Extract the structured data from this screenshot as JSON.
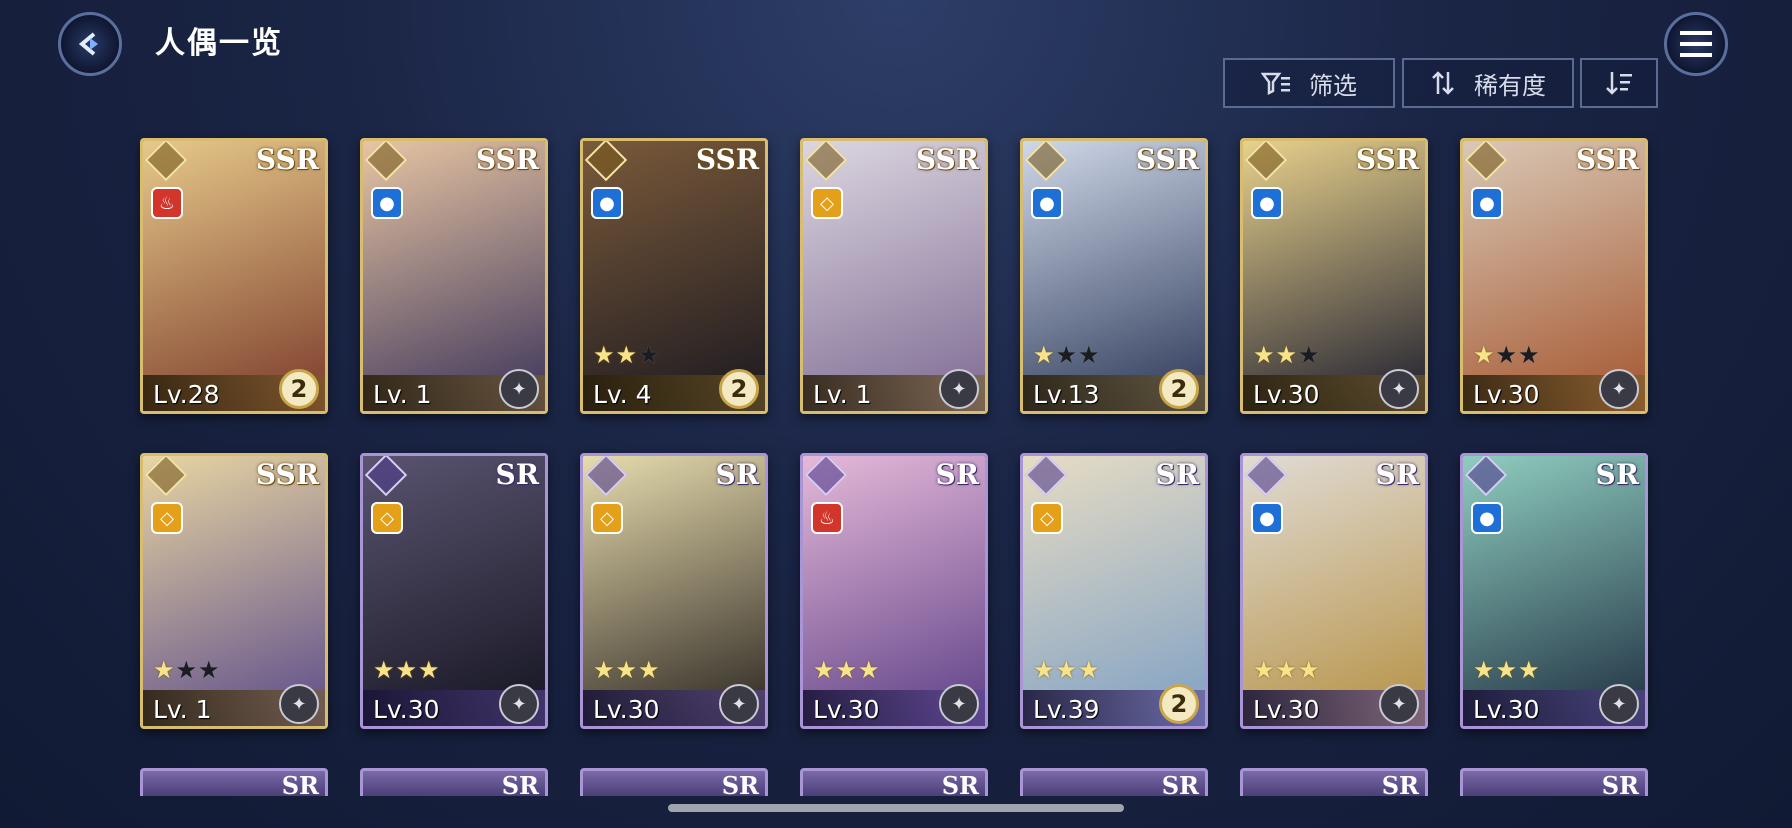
{
  "header": {
    "title": "人偶一览",
    "back_icon": "back-arrow-icon",
    "menu_icon": "hamburger-menu-icon"
  },
  "toolbar": {
    "filter_label": "筛选",
    "sort_label": "稀有度",
    "filter_icon": "filter-icon",
    "sort_icon": "sort-arrows-icon",
    "order_icon": "sort-order-icon"
  },
  "cards": [
    {
      "rarity": "SSR",
      "element": "fire",
      "stars": 0,
      "level": "Lv.28",
      "badge": "2",
      "colors": [
        "#e6c98a",
        "#7b3a2a"
      ]
    },
    {
      "rarity": "SSR",
      "element": "water",
      "stars": 0,
      "level": "Lv. 1",
      "badge": "",
      "colors": [
        "#e7c5a3",
        "#3a3359"
      ]
    },
    {
      "rarity": "SSR",
      "element": "water",
      "stars": 2,
      "level": "Lv. 4",
      "badge": "2",
      "colors": [
        "#7a5a3a",
        "#1a1820"
      ]
    },
    {
      "rarity": "SSR",
      "element": "light",
      "stars": 0,
      "level": "Lv. 1",
      "badge": "",
      "colors": [
        "#dcd6e0",
        "#7d6a92"
      ]
    },
    {
      "rarity": "SSR",
      "element": "water",
      "stars": 1,
      "level": "Lv.13",
      "badge": "2",
      "colors": [
        "#cfd8e8",
        "#2a3656"
      ]
    },
    {
      "rarity": "SSR",
      "element": "water",
      "stars": 2,
      "level": "Lv.30",
      "badge": "",
      "colors": [
        "#e8d18c",
        "#1b1c2e"
      ]
    },
    {
      "rarity": "SSR",
      "element": "water",
      "stars": 1,
      "level": "Lv.30",
      "badge": "",
      "colors": [
        "#d9c8b6",
        "#a4552e"
      ]
    },
    {
      "rarity": "SSR",
      "element": "light",
      "stars": 1,
      "level": "Lv. 1",
      "badge": "",
      "colors": [
        "#e8d5a2",
        "#5b4b8a"
      ]
    },
    {
      "rarity": "SR",
      "element": "light",
      "stars": 3,
      "level": "Lv.30",
      "badge": "",
      "colors": [
        "#5a5470",
        "#141420"
      ]
    },
    {
      "rarity": "SR",
      "element": "light",
      "stars": 3,
      "level": "Lv.30",
      "badge": "",
      "colors": [
        "#e7dcae",
        "#2a2420"
      ]
    },
    {
      "rarity": "SR",
      "element": "fire",
      "stars": 3,
      "level": "Lv.30",
      "badge": "",
      "colors": [
        "#e5b9d8",
        "#5c3f86"
      ]
    },
    {
      "rarity": "SR",
      "element": "light",
      "stars": 3,
      "level": "Lv.39",
      "badge": "2",
      "colors": [
        "#e7dcc4",
        "#7ea0c4"
      ]
    },
    {
      "rarity": "SR",
      "element": "water",
      "stars": 3,
      "level": "Lv.30",
      "badge": "",
      "colors": [
        "#e0dbd4",
        "#b59042"
      ]
    },
    {
      "rarity": "SR",
      "element": "water",
      "stars": 3,
      "level": "Lv.30",
      "badge": "",
      "colors": [
        "#8fcdbf",
        "#1e2e40"
      ]
    }
  ],
  "peek_row": [
    "SR",
    "SR",
    "SR",
    "SR",
    "SR",
    "SR",
    "SR"
  ]
}
